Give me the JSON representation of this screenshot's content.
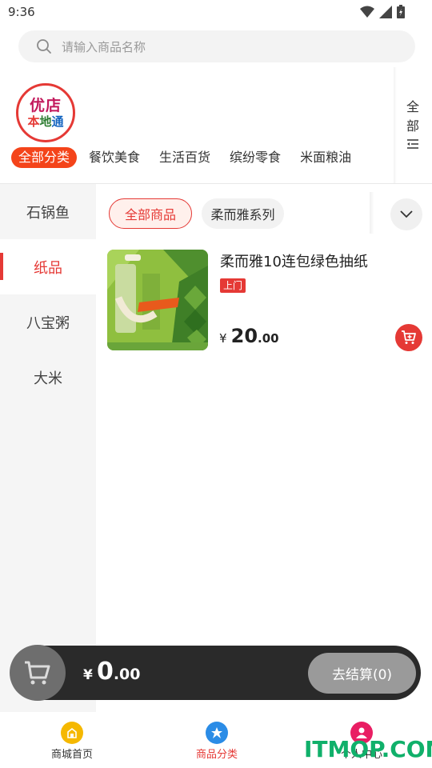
{
  "status_bar": {
    "time": "9:36",
    "icons": [
      "wifi-icon",
      "signal-icon",
      "battery-icon"
    ]
  },
  "search": {
    "placeholder": "请输入商品名称"
  },
  "logo": {
    "line1": "优店",
    "line2_a": "本",
    "line2_b": "地",
    "line2_c": "通"
  },
  "category_tabs": [
    {
      "label": "全部分类",
      "active": true
    },
    {
      "label": "餐饮美食",
      "active": false
    },
    {
      "label": "生活百货",
      "active": false
    },
    {
      "label": "缤纷零食",
      "active": false
    },
    {
      "label": "米面粮油",
      "active": false
    }
  ],
  "all_toggle": {
    "line1": "全",
    "line2": "部"
  },
  "sub_categories": [
    {
      "label": "石锅鱼",
      "active": false
    },
    {
      "label": "纸品",
      "active": true
    },
    {
      "label": "八宝粥",
      "active": false
    },
    {
      "label": "大米",
      "active": false
    }
  ],
  "filter_chips": [
    {
      "label": "全部商品",
      "active": true
    },
    {
      "label": "柔而雅系列",
      "active": false
    }
  ],
  "product": {
    "name": "柔而雅10连包绿色抽纸",
    "tag": "上门",
    "price_symbol": "¥",
    "price_int": "20",
    "price_dec": ".00"
  },
  "cart": {
    "currency": "¥",
    "total_int": "0",
    "total_dec": ".00",
    "checkout_label": "去结算(0)"
  },
  "bottom_nav": [
    {
      "label": "商城首页",
      "icon": "home-icon",
      "color": "#f5b800"
    },
    {
      "label": "商品分类",
      "icon": "category-icon",
      "color": "#2b8ce6",
      "active": true
    },
    {
      "label": "个人中心",
      "icon": "user-icon",
      "color": "#e91e63"
    }
  ],
  "watermark": "ITMOP.COM",
  "colors": {
    "accent": "#e53935",
    "tab_active": "#f4441a"
  }
}
